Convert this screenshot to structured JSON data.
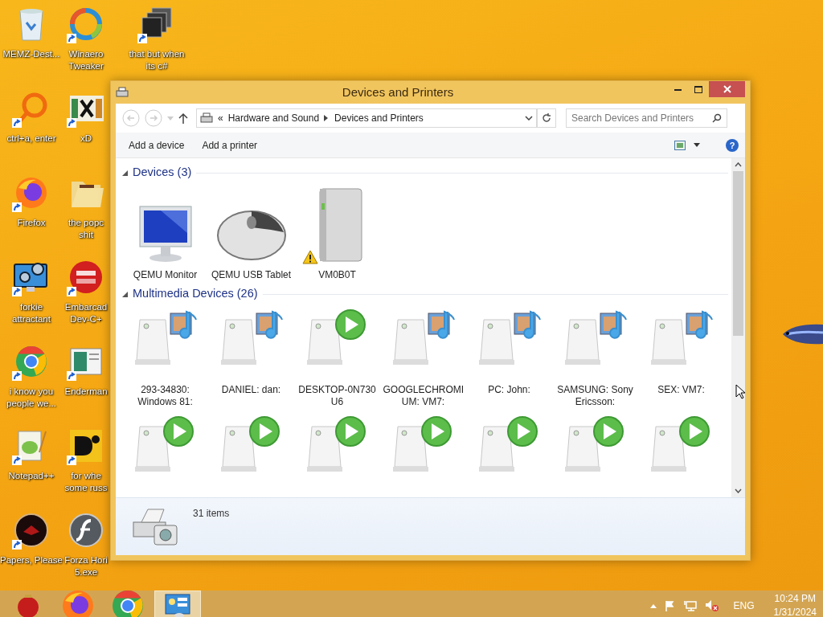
{
  "desktop": {
    "columns": [
      {
        "icons": [
          {
            "label": "MEMZ-Dest...",
            "kind": "bin",
            "shortcut": false
          },
          {
            "label": "ctrl+a, enter",
            "kind": "ring",
            "shortcut": true
          },
          {
            "label": "Firefox",
            "kind": "firefox",
            "shortcut": true
          },
          {
            "label": "forkie attractant",
            "kind": "gears",
            "shortcut": true
          },
          {
            "label": "i know you people we...",
            "kind": "chrome",
            "shortcut": true
          },
          {
            "label": "Notepad++",
            "kind": "notepad",
            "shortcut": true
          },
          {
            "label": "Papers, Please",
            "kind": "dark",
            "shortcut": true
          }
        ]
      },
      {
        "icons": [
          {
            "label": "Winaero Tweaker",
            "kind": "swirl",
            "shortcut": true
          },
          {
            "label": "xD",
            "kind": "hex",
            "shortcut": true
          },
          {
            "label": "the popc shit",
            "kind": "folder",
            "shortcut": false
          },
          {
            "label": "Embarcad Dev-C+",
            "kind": "devcpp",
            "shortcut": true
          },
          {
            "label": "Enderman",
            "kind": "screen",
            "shortcut": true
          },
          {
            "label": "for whe some russ",
            "kind": "yellow",
            "shortcut": true
          },
          {
            "label": "Forza Hori 5.exe",
            "kind": "flash",
            "shortcut": false
          }
        ]
      },
      {
        "icons": [
          {
            "label": "that but when its c#",
            "kind": "stack",
            "shortcut": true
          }
        ]
      }
    ]
  },
  "window": {
    "title": "Devices and Printers",
    "address": {
      "prefix": "«",
      "crumbs": [
        "Hardware and Sound",
        "Devices and Printers"
      ]
    },
    "search": {
      "placeholder": "Search Devices and Printers"
    },
    "commands": [
      "Add a device",
      "Add a printer"
    ],
    "help": "?",
    "groups": [
      {
        "title": "Devices (3)",
        "items": [
          {
            "label": "QEMU Monitor",
            "kind": "monitor",
            "warning": false
          },
          {
            "label": "QEMU USB Tablet",
            "kind": "mouse",
            "warning": false
          },
          {
            "label": "VM0B0T",
            "kind": "drive",
            "warning": true
          }
        ]
      },
      {
        "title": "Multimedia Devices (26)",
        "items": [
          {
            "label": "293-34830: Windows 81:",
            "kind": "media"
          },
          {
            "label": "DANIEL: dan:",
            "kind": "media"
          },
          {
            "label": "DESKTOP-0N730 U6",
            "kind": "play"
          },
          {
            "label": "GOOGLECHROMI UM: VM7:",
            "kind": "media"
          },
          {
            "label": "PC: John:",
            "kind": "media"
          },
          {
            "label": "SAMSUNG: Sony Ericsson:",
            "kind": "media"
          },
          {
            "label": "SEX: VM7:",
            "kind": "media"
          },
          {
            "kind": "play"
          },
          {
            "kind": "play"
          },
          {
            "kind": "play"
          },
          {
            "kind": "play"
          },
          {
            "kind": "play"
          },
          {
            "kind": "play"
          },
          {
            "kind": "play"
          }
        ]
      }
    ],
    "details": {
      "count": "31 items"
    }
  },
  "taskbar": {
    "buttons": [
      {
        "kind": "ornament",
        "selected": false
      },
      {
        "kind": "firefox",
        "selected": false
      },
      {
        "kind": "chrome",
        "selected": false
      },
      {
        "kind": "panel",
        "selected": true
      }
    ],
    "language": "ENG",
    "time": "10:24 PM",
    "date": "1/31/2024"
  }
}
